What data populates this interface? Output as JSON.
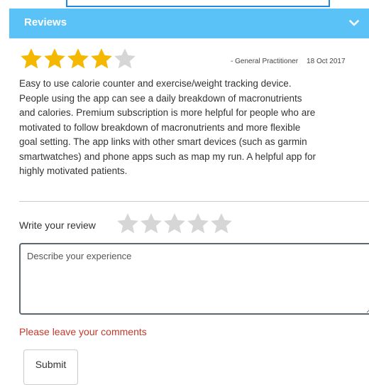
{
  "header": {
    "title": "Reviews",
    "toggle_icon": "chevron-down-icon"
  },
  "review": {
    "rating": 4,
    "max_rating": 5,
    "reviewer_role": "- General Practitioner",
    "date": "18 Oct 2017",
    "text_lines": [
      "Easy to use calorie counter and exercise/weight tracking device.",
      "People using the app can see a daily breakdown of macronutrients",
      "and calories. Premium subscription is more helpful for people who are",
      "motivated to follow breakdown of macronutrients and more flexible",
      "goal setting. The app links with other smart devices (such as garmin",
      "smartwatches) and phone apps such as map my run. A helpful app for",
      "highly motivated patients."
    ]
  },
  "write_review": {
    "label": "Write your review",
    "rating": 0,
    "textarea_value": "",
    "textarea_placeholder": "Describe your experience",
    "error_message": "Please leave your comments",
    "submit_label": "Submit"
  },
  "colors": {
    "header_bg": "#5bc2f7",
    "star_filled": "#f5b800",
    "star_empty": "#d6d6d6",
    "error": "#c0392b"
  }
}
